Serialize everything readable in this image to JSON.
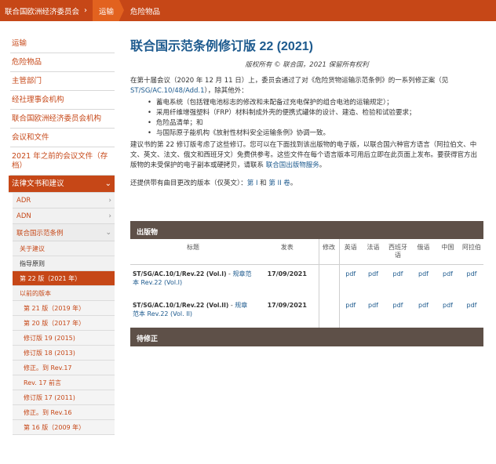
{
  "breadcrumb": {
    "items": [
      "联合国欧洲经济委员会",
      "运输",
      "危险物品"
    ],
    "separator": "›"
  },
  "sidebar": {
    "items": [
      "运输",
      "危险物品",
      "主管部门",
      "经社理事会机构",
      "联合国欧洲经济委员会机构",
      "会议和文件",
      "2021 年之前的会议文件（存档）"
    ],
    "selected": "法律文书和建议",
    "sub": [
      "ADR",
      "ADN",
      "联合国示范条例"
    ],
    "sub2": [
      "关于建议",
      "指导原则"
    ],
    "sub2_selected": "第 22 版（2021 年）",
    "sub2_after": "以前的版本",
    "sub3": [
      "第 21 版（2019 年）",
      "第 20 版（2017 年）",
      "修订版 19 (2015)",
      "修订版 18 (2013)",
      "修正。到 Rev.17",
      "Rev. 17 前言",
      "修订版 17 (2011)",
      "修正。到 Rev.16",
      "第 16 版（2009 年）"
    ]
  },
  "main": {
    "title": "联合国示范条例修订版 22 (2021)",
    "copyright": "版权所有 © 联合国，2021 保留所有权利",
    "intro_a": "在第十届会议（2020 年 12 月 11 日）上，委员会通过了对《危险货物运输示范条例》的一系列修正案（见 ",
    "intro_link": "ST/SG/AC.10/48/Add.1",
    "intro_b": "），除其他外：",
    "bullets": [
      "蓄电系统（包括锂电池标志的修改和未配备过充电保护的组合电池的运输规定）；",
      "采用纤维增强塑料（FRP）材料制成外壳的便携式罐体的设计、建造、检验和试验要求；",
      "危险品清单；和",
      "与国际原子能机构《放射性材料安全运输条例》协调一致。"
    ],
    "para2": "建议书的第 22 修订版考虑了这些修订。您可以在下面找到该出版物的电子版，以联合国六种官方语言（阿拉伯文、中文、英文、法文、俄文和西班牙文）免费供参考。这些文件在每个语言版本可用后立即在此页面上发布。要获得官方出版物的未受保护的电子副本或硬拷贝，请联系 ",
    "para2_link": "联合国出版物服务",
    "para2_end": "。",
    "volumes_a": "还提供带有曲目更改的版本（仅英文）：",
    "vol1": "第 I",
    "volumes_and": " 和 ",
    "vol2": "第 II 卷",
    "volumes_end": "。"
  },
  "publications": {
    "header": "出版物",
    "columns": [
      "标题",
      "发表",
      "修改",
      "英语",
      "法语",
      "西班牙语",
      "俄语",
      "中国",
      "阿拉伯"
    ],
    "rows": [
      {
        "code": "ST/SG/AC.10/1/Rev.22 (Vol.I)",
        "dash": " - ",
        "title": "规章范本 Rev.22 (Vol.I)",
        "date": "17/09/2021",
        "mod": "",
        "links": [
          "pdf",
          "pdf",
          "pdf",
          "pdf",
          "pdf",
          "pdf"
        ]
      },
      {
        "code": "ST/SG/AC.10/1/Rev.22 (Vol.II)",
        "dash": " - ",
        "title": "规章范本 Rev.22 (Vol. II)",
        "date": "17/09/2021",
        "mod": "",
        "links": [
          "pdf",
          "pdf",
          "pdf",
          "pdf",
          "pdf",
          "pdf"
        ]
      }
    ],
    "footer": "待修正"
  },
  "colors": {
    "brand": "#c64717",
    "link": "#1d5a8e",
    "header_bar": "#5e5048"
  }
}
